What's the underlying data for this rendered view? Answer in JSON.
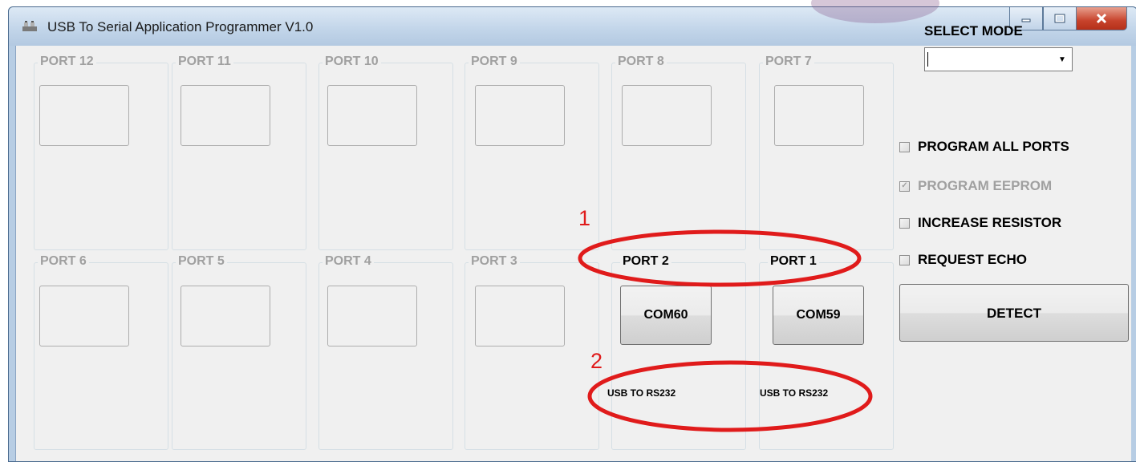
{
  "window": {
    "title": "USB To Serial Application Programmer V1.0",
    "controls": [
      "minimize",
      "maximize",
      "close"
    ]
  },
  "ports_top": [
    {
      "label": "PORT 12",
      "enabled": false
    },
    {
      "label": "PORT 11",
      "enabled": false
    },
    {
      "label": "PORT 10",
      "enabled": false
    },
    {
      "label": "PORT 9",
      "enabled": false
    },
    {
      "label": "PORT 8",
      "enabled": false
    },
    {
      "label": "PORT 7",
      "enabled": false
    }
  ],
  "ports_bottom": [
    {
      "label": "PORT 6",
      "enabled": false
    },
    {
      "label": "PORT 5",
      "enabled": false
    },
    {
      "label": "PORT 4",
      "enabled": false
    },
    {
      "label": "PORT 3",
      "enabled": false
    },
    {
      "label": "PORT 2",
      "enabled": true,
      "com": "COM60",
      "type": "USB TO RS232"
    },
    {
      "label": "PORT 1",
      "enabled": true,
      "com": "COM59",
      "type": "USB TO RS232"
    }
  ],
  "side": {
    "select_mode_label": "SELECT MODE",
    "mode_value": "",
    "options": [
      {
        "label": "PROGRAM ALL PORTS",
        "checked": false,
        "enabled": true
      },
      {
        "label": "PROGRAM EEPROM",
        "checked": true,
        "enabled": false
      },
      {
        "label": "INCREASE RESISTOR",
        "checked": false,
        "enabled": true
      },
      {
        "label": "REQUEST ECHO",
        "checked": false,
        "enabled": true
      }
    ],
    "detect_label": "DETECT"
  },
  "annotations": [
    {
      "number": "1",
      "color": "#e01b1b"
    },
    {
      "number": "2",
      "color": "#e01b1b"
    }
  ],
  "colors": {
    "annotation": "#e01b1b",
    "disabled_text": "#a0a0a0",
    "titlebar": "#c3d6ea"
  }
}
